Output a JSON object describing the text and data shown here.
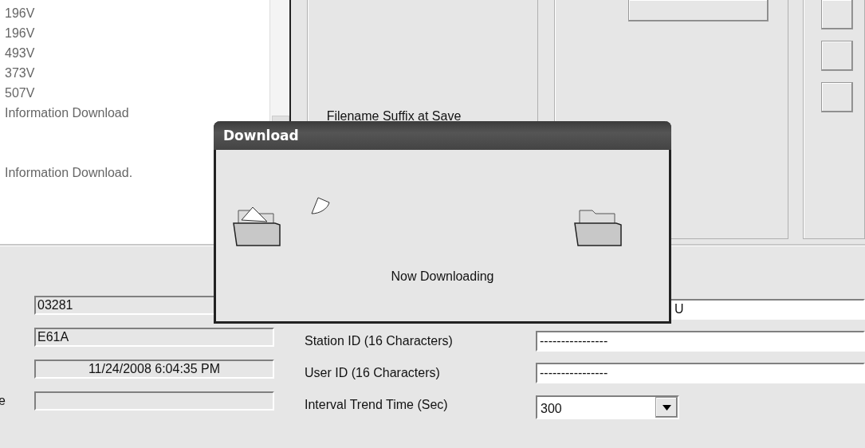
{
  "log_lines": [
    "196V",
    "196V",
    "493V",
    "373V",
    "507V",
    "Information Download"
  ],
  "log_footer": "Information Download.",
  "settings_panel": {
    "label": "Filename Suffix at Save"
  },
  "left_fields": [
    {
      "kind": "text",
      "value": "03281"
    },
    {
      "kind": "text",
      "value": "E61A"
    },
    {
      "kind": "readonly",
      "value": "11/24/2008 6:04:35 PM"
    },
    {
      "kind": "readonly",
      "label": "e"
    }
  ],
  "right_fields": [
    {
      "kind": "text",
      "value": "U",
      "covered": true
    },
    {
      "kind": "text",
      "label": "Station ID (16 Characters)",
      "value": "----------------"
    },
    {
      "kind": "text",
      "label": "User ID (16 Characters)",
      "value": "----------------"
    },
    {
      "kind": "dropdown",
      "label": "Interval Trend Time (Sec)",
      "value": "300"
    }
  ],
  "dialog": {
    "title": "Download",
    "message": "Now Downloading"
  }
}
